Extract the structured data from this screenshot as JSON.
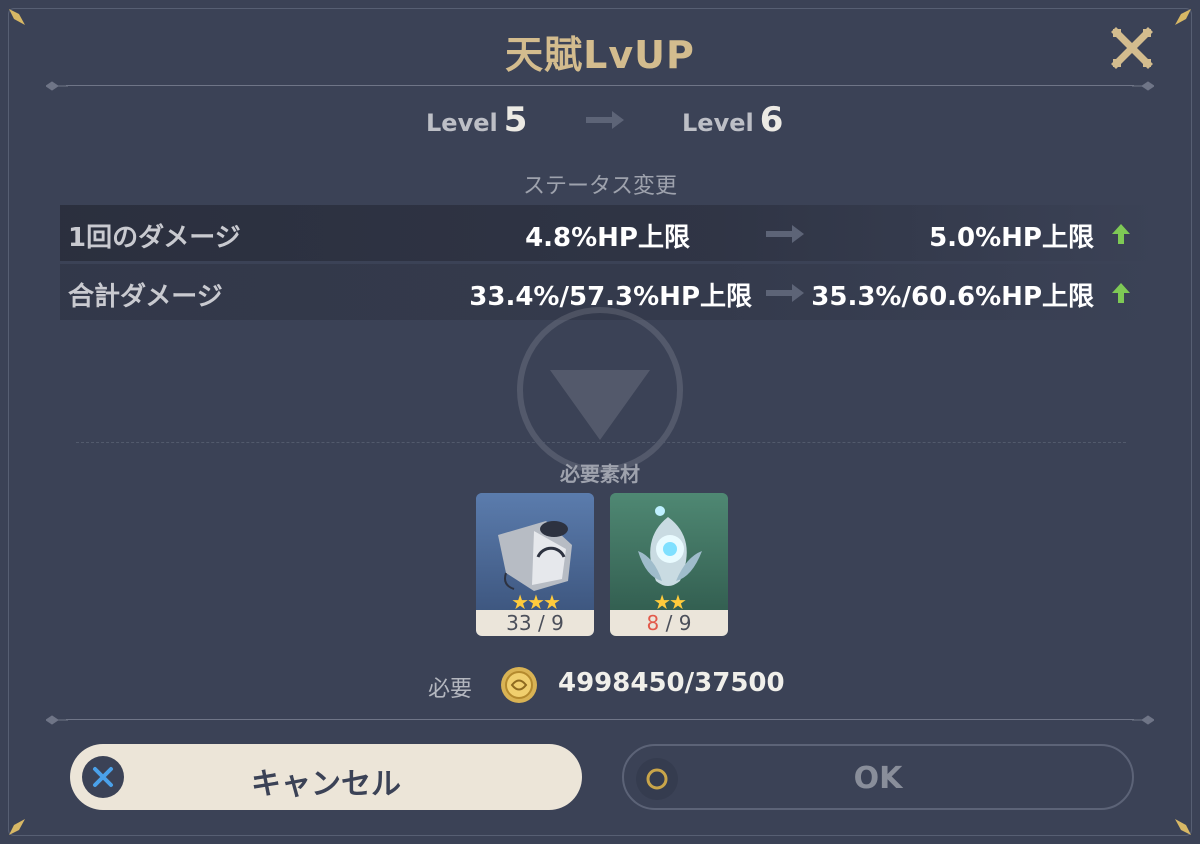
{
  "dialog": {
    "title": "天賦LvUP"
  },
  "levels": {
    "from_label": "Level",
    "from_value": "5",
    "to_label": "Level",
    "to_value": "6"
  },
  "status": {
    "section_label": "ステータス変更",
    "rows": [
      {
        "name": "1回のダメージ",
        "old": "4.8%HP上限",
        "new": "5.0%HP上限"
      },
      {
        "name": "合計ダメージ",
        "old": "33.4%/57.3%HP上限",
        "new": "35.3%/60.6%HP上限"
      }
    ]
  },
  "materials": {
    "section_label": "必要素材",
    "items": [
      {
        "icon": "bundle-material-icon",
        "stars": "★★★",
        "have": "33",
        "need": "/ 9",
        "color": "#4c6a96"
      },
      {
        "icon": "crystal-flower-material-icon",
        "stars": "★★",
        "have": "8",
        "need": "/ 9",
        "color": "#3f7363"
      }
    ]
  },
  "cost": {
    "label": "必要",
    "icon": "mora-coin-icon",
    "value": "4998450/37500"
  },
  "buttons": {
    "cancel_label": "キャンセル",
    "ok_label": "OK"
  },
  "colors": {
    "accent_gold": "#d3bc8e",
    "up_green": "#7ec955",
    "insufficient_red": "#e25a4b"
  }
}
